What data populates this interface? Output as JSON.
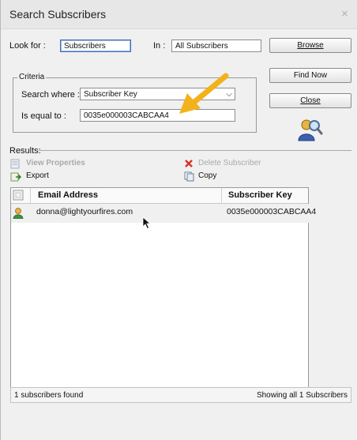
{
  "dialog": {
    "title": "Search Subscribers",
    "close_glyph": "×"
  },
  "search": {
    "look_for_label": "Look for :",
    "look_for_value": "Subscribers",
    "in_label": "In :",
    "in_value": "All Subscribers",
    "browse_label": "Browse"
  },
  "criteria": {
    "legend": "Criteria",
    "search_where_label": "Search where :",
    "search_where_value": "Subscriber Key",
    "is_equal_label": "Is equal to :",
    "is_equal_value": "0035e000003CABCAA4"
  },
  "buttons": {
    "find_now": "Find Now",
    "close": "Close"
  },
  "results": {
    "label": "Results:",
    "view_properties": "View Properties",
    "delete_subscriber": "Delete Subscriber",
    "export": "Export",
    "copy": "Copy",
    "columns": [
      "Email Address",
      "Subscriber Key"
    ],
    "rows": [
      {
        "email": "donna@lightyourfires.com",
        "key": "0035e000003CABCAA4"
      }
    ],
    "status_left": "1 subscribers found",
    "status_right": "Showing all 1 Subscribers"
  },
  "colors": {
    "arrow": "#f2b21c",
    "accent": "#3b6fb6"
  }
}
